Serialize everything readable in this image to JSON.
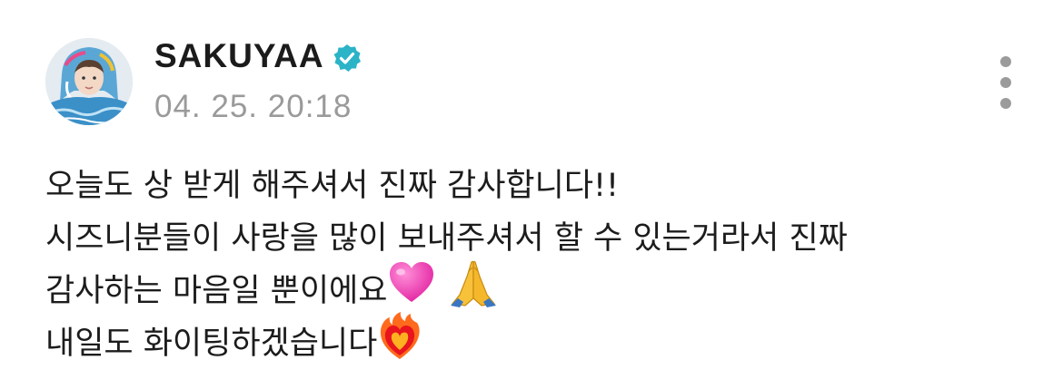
{
  "post": {
    "author": "SAKUYAA",
    "verified": true,
    "timestamp": "04. 25. 20:18",
    "lines": [
      "오늘도 상 받게 해주셔서 진짜 감사합니다!!",
      "시즈니분들이 사랑을 많이 보내주셔서 할 수 있는거라서 진짜",
      "감사하는 마음일 뿐이에요",
      "내일도 화이팅하겠습니다"
    ],
    "emojis": {
      "line3": [
        "pink-heart-icon",
        "folded-hands-icon"
      ],
      "line4": [
        "heart-on-fire-icon"
      ]
    }
  },
  "colors": {
    "verified_badge": "#2bb3c7",
    "timestamp": "#9a9a9a",
    "more_dots": "#9b9b9b"
  }
}
